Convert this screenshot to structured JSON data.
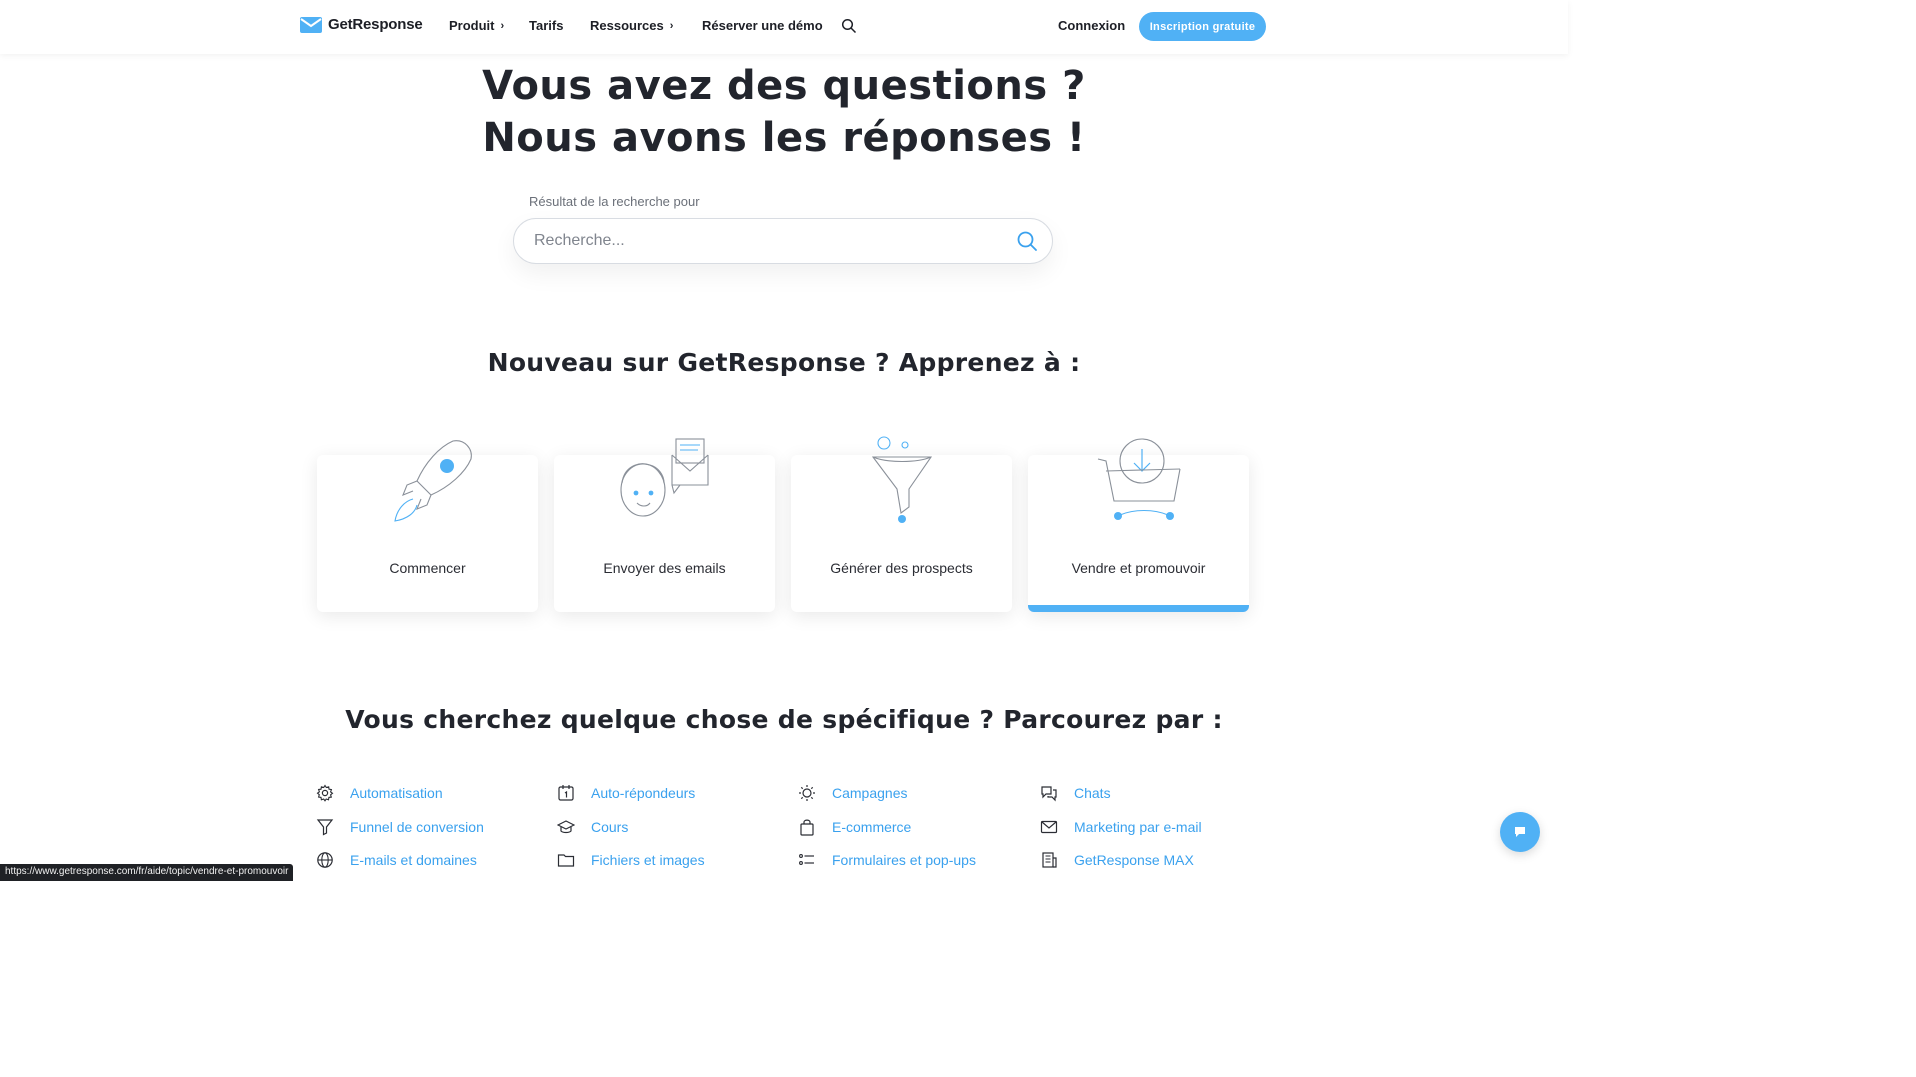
{
  "header": {
    "logo_text": "GetResponse",
    "nav": [
      {
        "label": "Produit",
        "has_chevron": true
      },
      {
        "label": "Tarifs",
        "has_chevron": false
      },
      {
        "label": "Ressources",
        "has_chevron": true
      },
      {
        "label": "Réserver une démo",
        "has_chevron": false
      }
    ],
    "search_icon": "search-icon",
    "login_label": "Connexion",
    "signup_label": "Inscription gratuite"
  },
  "hero": {
    "title_line1": "Vous avez des questions ?",
    "title_line2": "Nous avons les réponses !",
    "search_label": "Résultat de la recherche pour",
    "search_placeholder": "Recherche..."
  },
  "learn": {
    "heading": "Nouveau sur GetResponse ? Apprenez à :",
    "cards": [
      {
        "label": "Commencer",
        "icon": "rocket-icon",
        "active": false
      },
      {
        "label": "Envoyer des emails",
        "icon": "person-email-icon",
        "active": false
      },
      {
        "label": "Générer des prospects",
        "icon": "funnel-icon",
        "active": false
      },
      {
        "label": "Vendre et promouvoir",
        "icon": "cart-icon",
        "active": true
      }
    ]
  },
  "browse": {
    "heading": "Vous cherchez quelque chose de spécifique ? Parcourez par :",
    "topics": [
      {
        "label": "Automatisation",
        "icon": "gear-icon"
      },
      {
        "label": "Auto-répondeurs",
        "icon": "calendar-icon"
      },
      {
        "label": "Campagnes",
        "icon": "sun-icon"
      },
      {
        "label": "Chats",
        "icon": "chat-bubbles-icon"
      },
      {
        "label": "Funnel de conversion",
        "icon": "filter-icon"
      },
      {
        "label": "Cours",
        "icon": "graduation-cap-icon"
      },
      {
        "label": "E-commerce",
        "icon": "shopping-bag-icon"
      },
      {
        "label": "Marketing par e-mail",
        "icon": "envelope-icon"
      },
      {
        "label": "E-mails et domaines",
        "icon": "globe-icon"
      },
      {
        "label": "Fichiers et images",
        "icon": "folder-icon"
      },
      {
        "label": "Formulaires et pop-ups",
        "icon": "list-icon"
      },
      {
        "label": "GetResponse MAX",
        "icon": "building-icon"
      }
    ]
  },
  "status_url": "https://www.getresponse.com/fr/aide/topic/vendre-et-promouvoir",
  "colors": {
    "accent": "#50b1f5",
    "link": "#3aa1ee",
    "text": "#22252d"
  }
}
